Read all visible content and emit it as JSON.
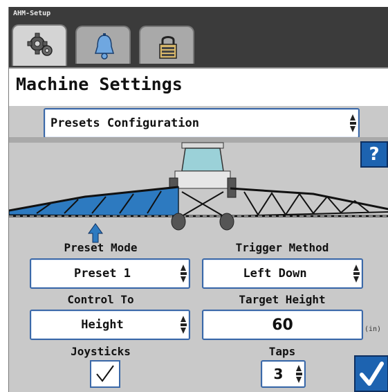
{
  "window": {
    "app_name": "AHM-Setup"
  },
  "tabs": [
    {
      "name": "settings",
      "icon": "gear-icon",
      "active": true
    },
    {
      "name": "alarms",
      "icon": "bell-icon",
      "active": false
    },
    {
      "name": "lock",
      "icon": "lock-icon",
      "active": false
    }
  ],
  "header": {
    "title": "Machine Settings"
  },
  "config_select": {
    "value": "Presets Configuration"
  },
  "help_button": {
    "label": "?"
  },
  "preset_mode": {
    "label": "Preset Mode",
    "value": "Preset 1"
  },
  "trigger_method": {
    "label": "Trigger Method",
    "value": "Left Down"
  },
  "control_to": {
    "label": "Control To",
    "value": "Height"
  },
  "target_height": {
    "label": "Target Height",
    "value": "60",
    "unit": "(in)"
  },
  "joysticks": {
    "label": "Joysticks",
    "checked": true
  },
  "taps": {
    "label": "Taps",
    "value": "3"
  },
  "colors": {
    "accent": "#1d63b0",
    "boom_active": "#2d7ac0",
    "panel": "#c9c9c9"
  }
}
